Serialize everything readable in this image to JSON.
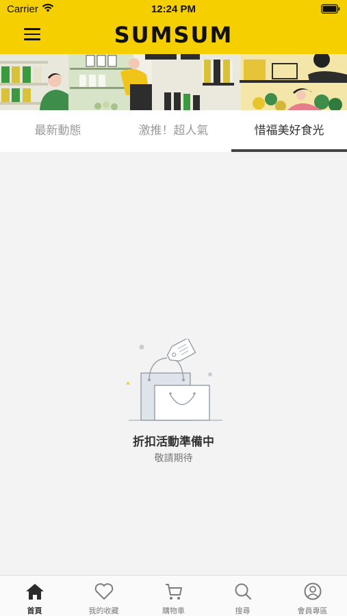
{
  "status_bar": {
    "carrier": "Carrier",
    "time": "12:24 PM"
  },
  "header": {
    "brand": "SUMSUM"
  },
  "tabs": [
    {
      "label": "最新動態"
    },
    {
      "label": "激推！超人氣"
    },
    {
      "label": "惜福美好食光"
    }
  ],
  "active_tab": 2,
  "empty_state": {
    "title": "折扣活動準備中",
    "subtitle": "敬請期待"
  },
  "tabbar": {
    "items": [
      {
        "label": "首頁",
        "icon": "home-icon"
      },
      {
        "label": "我的收藏",
        "icon": "heart-icon"
      },
      {
        "label": "購物車",
        "icon": "cart-icon"
      },
      {
        "label": "搜尋",
        "icon": "search-icon"
      },
      {
        "label": "會員專區",
        "icon": "user-icon"
      }
    ],
    "active": 0
  },
  "colors": {
    "brand_yellow": "#f5cf00",
    "active_text": "#333333",
    "inactive_text": "#9a9a9a"
  }
}
